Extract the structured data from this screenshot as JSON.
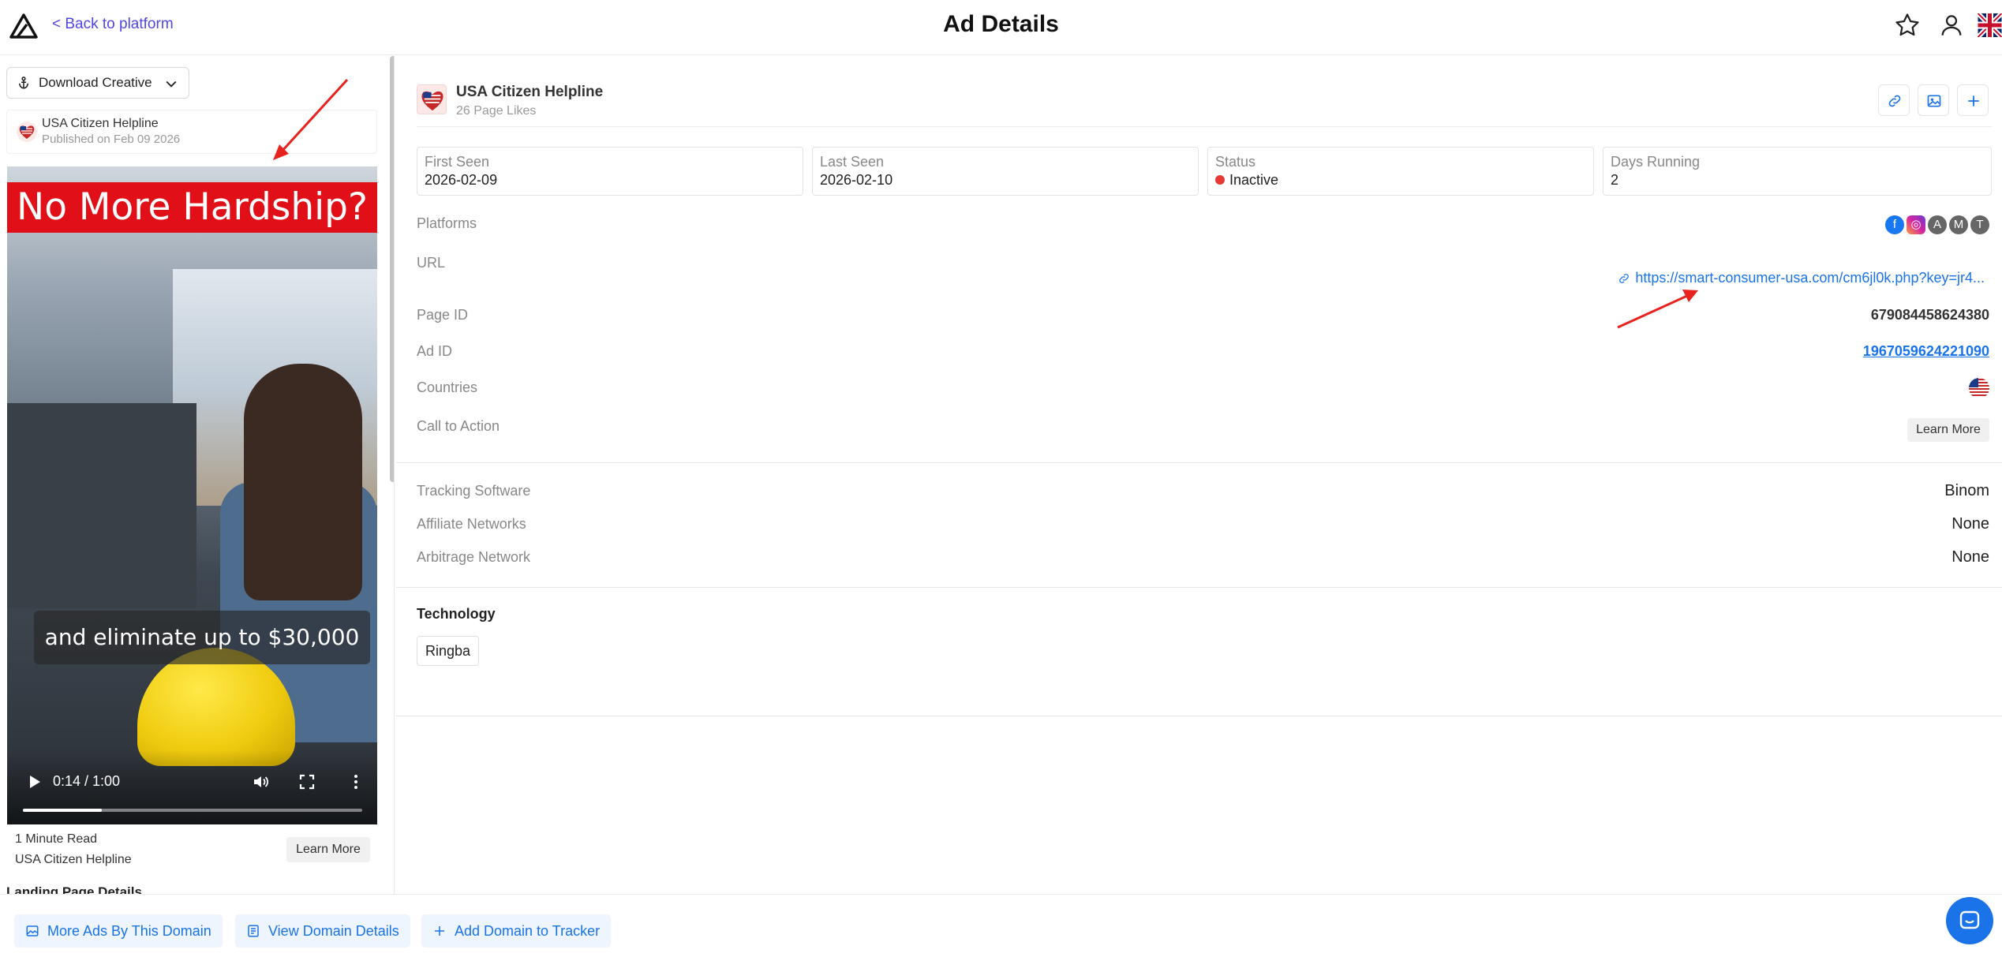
{
  "header": {
    "back_label": "< Back to platform",
    "title": "Ad Details",
    "icons": [
      "logo-icon",
      "star-icon",
      "user-icon",
      "uk-flag-icon"
    ]
  },
  "left": {
    "download_label": "Download Creative",
    "card": {
      "advertiser": "USA Citizen Helpline",
      "published": "Published on Feb 09 2026"
    },
    "video": {
      "banner": "No More Hardship?",
      "caption": "and eliminate up to $30,000",
      "time": "0:14 / 1:00",
      "progress": 0.233
    },
    "footer": {
      "line1": "1 Minute Read",
      "line2": "USA Citizen Helpline",
      "cta": "Learn More"
    },
    "landing_title": "Landing Page Details"
  },
  "right": {
    "advertiser": "USA Citizen Helpline",
    "likes": "26 Page Likes",
    "stats": [
      {
        "label": "First Seen",
        "value": "2026-02-09"
      },
      {
        "label": "Last Seen",
        "value": "2026-02-10"
      },
      {
        "label": "Status",
        "value": "Inactive"
      },
      {
        "label": "Days Running",
        "value": "2"
      }
    ],
    "rows": {
      "platforms_label": "Platforms",
      "url_label": "URL",
      "url_value": "https://smart-consumer-usa.com/cm6jl0k.php?key=jr4...",
      "page_id_label": "Page ID",
      "page_id_value": "679084458624380",
      "ad_id_label": "Ad ID",
      "ad_id_value": "1967059624221090",
      "countries_label": "Countries",
      "cta_label": "Call to Action",
      "cta_value": "Learn More"
    },
    "platform_letters": [
      "A",
      "M",
      "T"
    ],
    "tracking": {
      "tracking_label": "Tracking Software",
      "tracking_value": "Binom",
      "affiliate_label": "Affiliate Networks",
      "affiliate_value": "None",
      "arbitrage_label": "Arbitrage Network",
      "arbitrage_value": "None"
    },
    "technology_title": "Technology",
    "technology_items": [
      "Ringba"
    ]
  },
  "bottom": {
    "more_ads": "More Ads By This Domain",
    "view_domain": "View Domain Details",
    "add_domain": "Add Domain to Tracker"
  },
  "colors": {
    "accent": "#1a73e8",
    "back_link": "#4f46e5",
    "status_inactive": "#e53935",
    "banner_red": "#e10f17"
  }
}
